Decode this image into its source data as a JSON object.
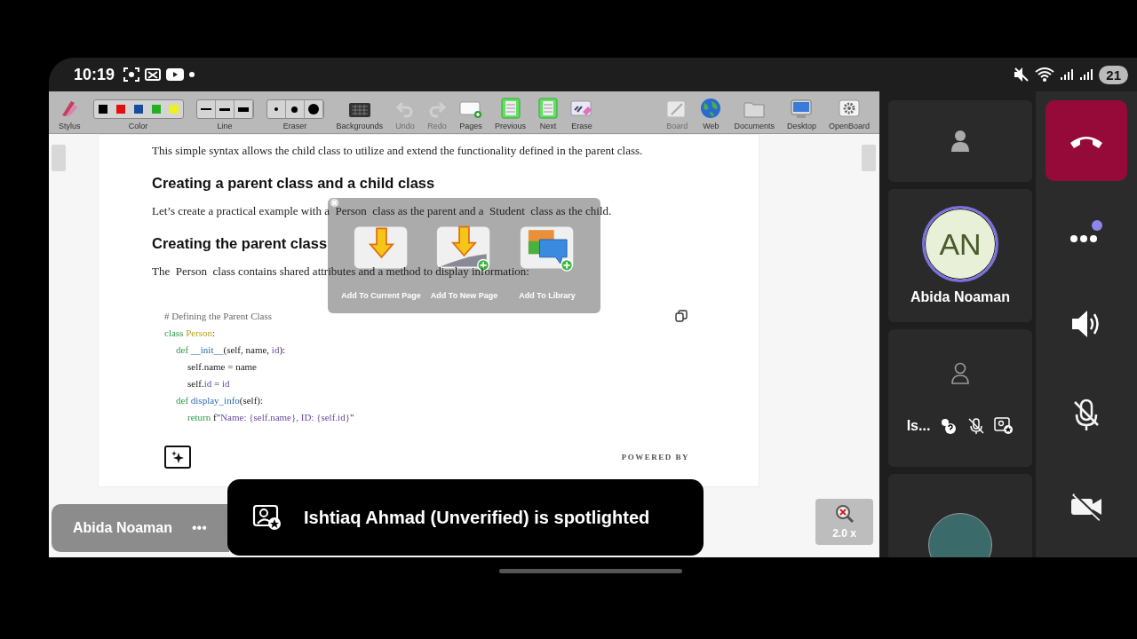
{
  "status_bar": {
    "time": "10:19",
    "battery": "21"
  },
  "toolbar": {
    "left": [
      {
        "kind": "stylus",
        "label": "Stylus",
        "disabled": false
      },
      {
        "kind": "colors",
        "label": "Color",
        "disabled": false,
        "swatches": [
          {
            "color": "#000000"
          },
          {
            "color": "#e01010"
          },
          {
            "color": "#1a4c9c"
          },
          {
            "color": "#22b022"
          },
          {
            "color": "#f0f020"
          }
        ]
      },
      {
        "kind": "lines",
        "label": "Line",
        "disabled": false
      },
      {
        "kind": "eraser",
        "label": "Eraser",
        "disabled": false
      },
      {
        "kind": "backgrounds",
        "label": "Backgrounds",
        "disabled": false
      },
      {
        "kind": "undo",
        "label": "Undo",
        "disabled": true
      },
      {
        "kind": "redo",
        "label": "Redo",
        "disabled": true
      },
      {
        "kind": "pages",
        "label": "Pages",
        "disabled": false
      },
      {
        "kind": "previous",
        "label": "Previous",
        "disabled": false
      },
      {
        "kind": "next",
        "label": "Next",
        "disabled": false
      },
      {
        "kind": "erase",
        "label": "Erase",
        "disabled": false
      }
    ],
    "right": [
      {
        "kind": "board",
        "label": "Board",
        "disabled": true
      },
      {
        "kind": "web",
        "label": "Web",
        "disabled": false
      },
      {
        "kind": "documents",
        "label": "Documents",
        "disabled": false
      },
      {
        "kind": "desktop",
        "label": "Desktop",
        "disabled": false
      },
      {
        "kind": "openboard",
        "label": "OpenBoard",
        "disabled": false
      }
    ]
  },
  "document": {
    "blocks": [
      {
        "kind": "text",
        "text": "This simple syntax allows the child class to utilize and extend the functionality defined in the parent class."
      },
      {
        "kind": "heading",
        "text": "Creating a parent class and a child class"
      },
      {
        "kind": "text",
        "text": "Let’s create a practical example with a  Person  class as the parent and a  Student  class as the child."
      },
      {
        "kind": "heading",
        "text": "Creating the parent class"
      },
      {
        "kind": "text",
        "text": "The  Person  class contains shared attributes and a method to display information:"
      }
    ],
    "code": [
      {
        "tokens": [
          {
            "kind": "comment",
            "text": "# Defining the Parent Class"
          }
        ]
      },
      {
        "tokens": [
          {
            "kind": "keyword",
            "text": "class "
          },
          {
            "kind": "classname",
            "text": "Person"
          },
          {
            "kind": "plain",
            "text": ":"
          }
        ],
        "children": [
          {
            "tokens": [
              {
                "kind": "keyword",
                "text": "def "
              },
              {
                "kind": "func",
                "text": "__init__"
              },
              {
                "kind": "plain",
                "text": "(self, name, "
              },
              {
                "kind": "param",
                "text": "id"
              },
              {
                "kind": "plain",
                "text": "):"
              }
            ],
            "children": [
              {
                "tokens": [
                  {
                    "kind": "plain",
                    "text": "self.name = name"
                  }
                ]
              },
              {
                "tokens": [
                  {
                    "kind": "plain",
                    "text": "self."
                  },
                  {
                    "kind": "param",
                    "text": "id"
                  },
                  {
                    "kind": "plain",
                    "text": " = "
                  },
                  {
                    "kind": "param",
                    "text": "id"
                  }
                ]
              }
            ]
          },
          {
            "tokens": [
              {
                "kind": "keyword",
                "text": "def "
              },
              {
                "kind": "func",
                "text": "display_info"
              },
              {
                "kind": "plain",
                "text": "(self):"
              }
            ],
            "children": [
              {
                "tokens": [
                  {
                    "kind": "keyword",
                    "text": "return "
                  },
                  {
                    "kind": "plain",
                    "text": "f\""
                  },
                  {
                    "kind": "string",
                    "text": "Name: {self.name}, ID: {self.id}"
                  },
                  {
                    "kind": "plain",
                    "text": "\""
                  }
                ]
              }
            ]
          }
        ]
      }
    ],
    "powered_by": "POWERED BY"
  },
  "popup": {
    "items": [
      {
        "kind": "current",
        "label": "Add To Current Page"
      },
      {
        "kind": "new",
        "label": "Add To New Page"
      },
      {
        "kind": "library",
        "label": "Add To Library"
      }
    ]
  },
  "name_tag": {
    "name": "Abida Noaman",
    "more": "•••"
  },
  "toast": {
    "text": "Ishtiaq Ahmad (Unverified) is spotlighted"
  },
  "zoom": {
    "label": "2.0 x"
  },
  "participants": [
    {
      "kind": "placeholder"
    },
    {
      "kind": "initials",
      "initials": "AN",
      "name": "Abida Noaman"
    },
    {
      "kind": "status",
      "name": "Is..."
    },
    {
      "kind": "photo"
    }
  ],
  "controls": [
    {
      "kind": "end_call"
    },
    {
      "kind": "more",
      "notification": true
    },
    {
      "kind": "speaker",
      "muted": false
    },
    {
      "kind": "mic",
      "muted": true
    },
    {
      "kind": "camera",
      "muted": true
    }
  ]
}
